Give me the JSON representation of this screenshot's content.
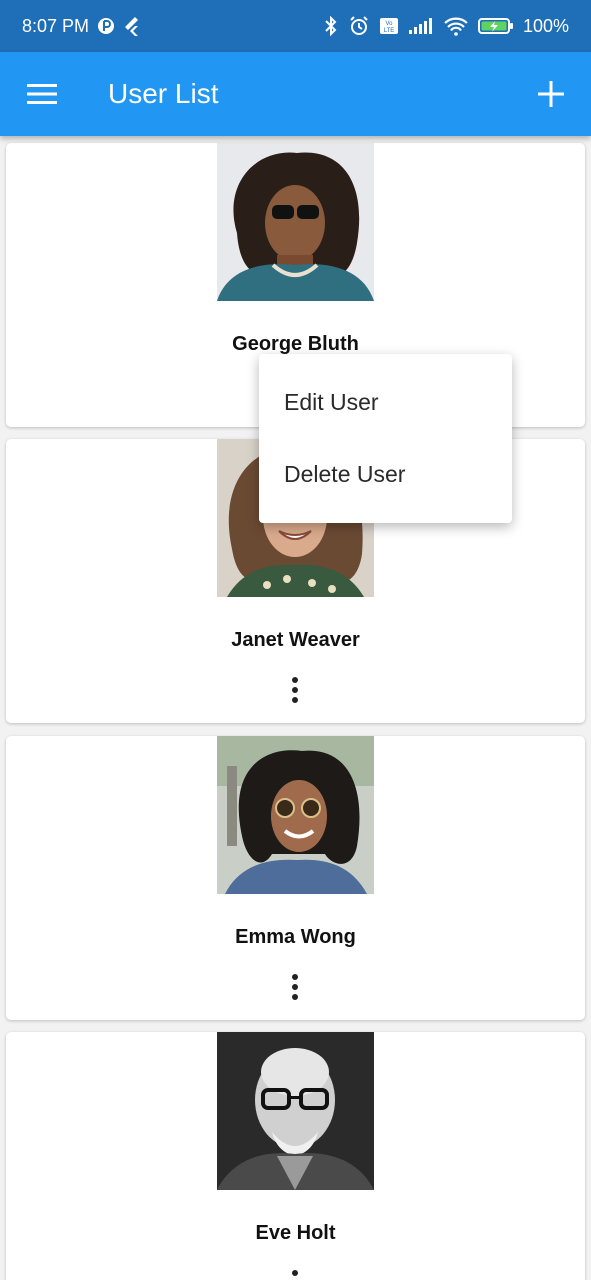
{
  "status_bar": {
    "time": "8:07 PM",
    "battery": "100%",
    "icons": [
      "p-icon",
      "flutter-icon",
      "bluetooth-icon",
      "alarm-icon",
      "volte-icon",
      "signal-icon",
      "wifi-icon",
      "battery-charging-icon"
    ]
  },
  "app_bar": {
    "title": "User List",
    "menu_icon": "menu-icon",
    "add_icon": "add-icon",
    "color": "#2196f3"
  },
  "users": [
    {
      "name": "George Bluth"
    },
    {
      "name": "Janet Weaver"
    },
    {
      "name": "Emma Wong"
    },
    {
      "name": "Eve Holt"
    }
  ],
  "popup_menu": {
    "items": [
      {
        "label": "Edit User"
      },
      {
        "label": "Delete User"
      }
    ]
  }
}
